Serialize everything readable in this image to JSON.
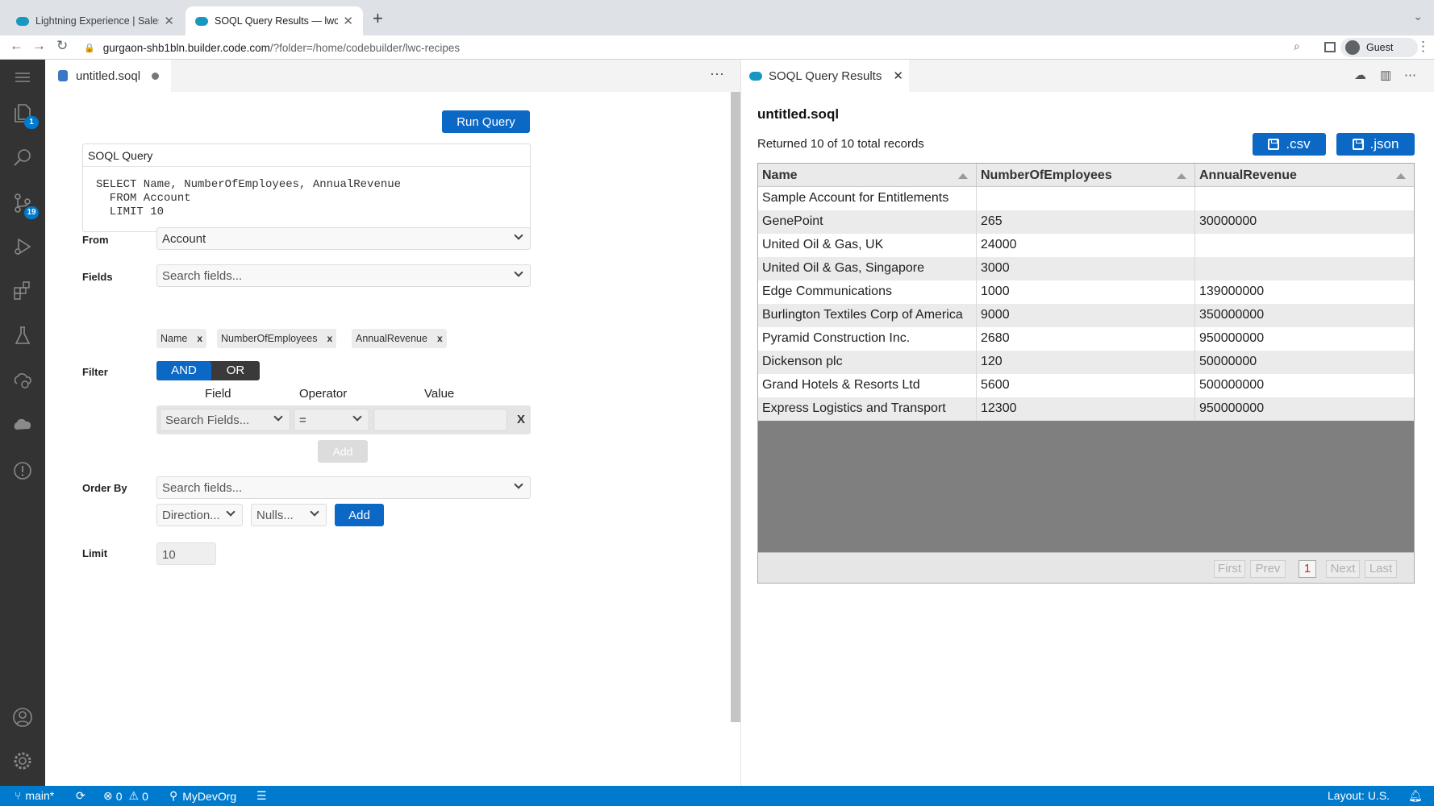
{
  "browser": {
    "tabs": [
      {
        "title": "Lightning Experience | Salesfor"
      },
      {
        "title": "SOQL Query Results — lwc-re"
      }
    ],
    "url_host": "gurgaon-shb1bln.builder.code.com",
    "url_path": "/?folder=/home/codebuilder/lwc-recipes",
    "profile_label": "Guest"
  },
  "activity_bar": {
    "explorer_badge": "1",
    "scm_badge": "19"
  },
  "editor": {
    "tab_title": "untitled.soql",
    "run_query_label": "Run Query",
    "soql_header": "SOQL Query",
    "soql_text": "SELECT Name, NumberOfEmployees, AnnualRevenue\n  FROM Account\n  LIMIT 10",
    "from_label": "From",
    "from_value": "Account",
    "fields_label": "Fields",
    "fields_placeholder": "Search fields...",
    "selected_fields": [
      "Name",
      "NumberOfEmployees",
      "AnnualRevenue"
    ],
    "pill_remove": "x",
    "filter_label": "Filter",
    "and_label": "AND",
    "or_label": "OR",
    "filter_col_field": "Field",
    "filter_col_operator": "Operator",
    "filter_col_value": "Value",
    "filter_field_placeholder": "Search Fields...",
    "filter_operator_value": "=",
    "filter_remove": "X",
    "filter_add_label": "Add",
    "orderby_label": "Order By",
    "orderby_placeholder": "Search fields...",
    "direction_placeholder": "Direction...",
    "nulls_placeholder": "Nulls...",
    "orderby_add_label": "Add",
    "limit_label": "Limit",
    "limit_value": "10"
  },
  "results": {
    "tab_title": "SOQL Query Results",
    "title": "untitled.soql",
    "summary": "Returned 10 of 10 total records",
    "csv_label": ".csv",
    "json_label": ".json",
    "columns": [
      "Name",
      "NumberOfEmployees",
      "AnnualRevenue"
    ],
    "rows": [
      [
        "Sample Account for Entitlements",
        "",
        ""
      ],
      [
        "GenePoint",
        "265",
        "30000000"
      ],
      [
        "United Oil & Gas, UK",
        "24000",
        ""
      ],
      [
        "United Oil & Gas, Singapore",
        "3000",
        ""
      ],
      [
        "Edge Communications",
        "1000",
        "139000000"
      ],
      [
        "Burlington Textiles Corp of America",
        "9000",
        "350000000"
      ],
      [
        "Pyramid Construction Inc.",
        "2680",
        "950000000"
      ],
      [
        "Dickenson plc",
        "120",
        "50000000"
      ],
      [
        "Grand Hotels & Resorts Ltd",
        "5600",
        "500000000"
      ],
      [
        "Express Logistics and Transport",
        "12300",
        "950000000"
      ]
    ],
    "pager": {
      "first": "First",
      "prev": "Prev",
      "current": "1",
      "next": "Next",
      "last": "Last"
    }
  },
  "statusbar": {
    "branch": "main*",
    "errors": "0",
    "warnings": "0",
    "org": "MyDevOrg",
    "layout": "Layout: U.S."
  },
  "colors": {
    "accent": "#0b68c4",
    "statusbar": "#007acc",
    "activity_bar": "#333333"
  }
}
